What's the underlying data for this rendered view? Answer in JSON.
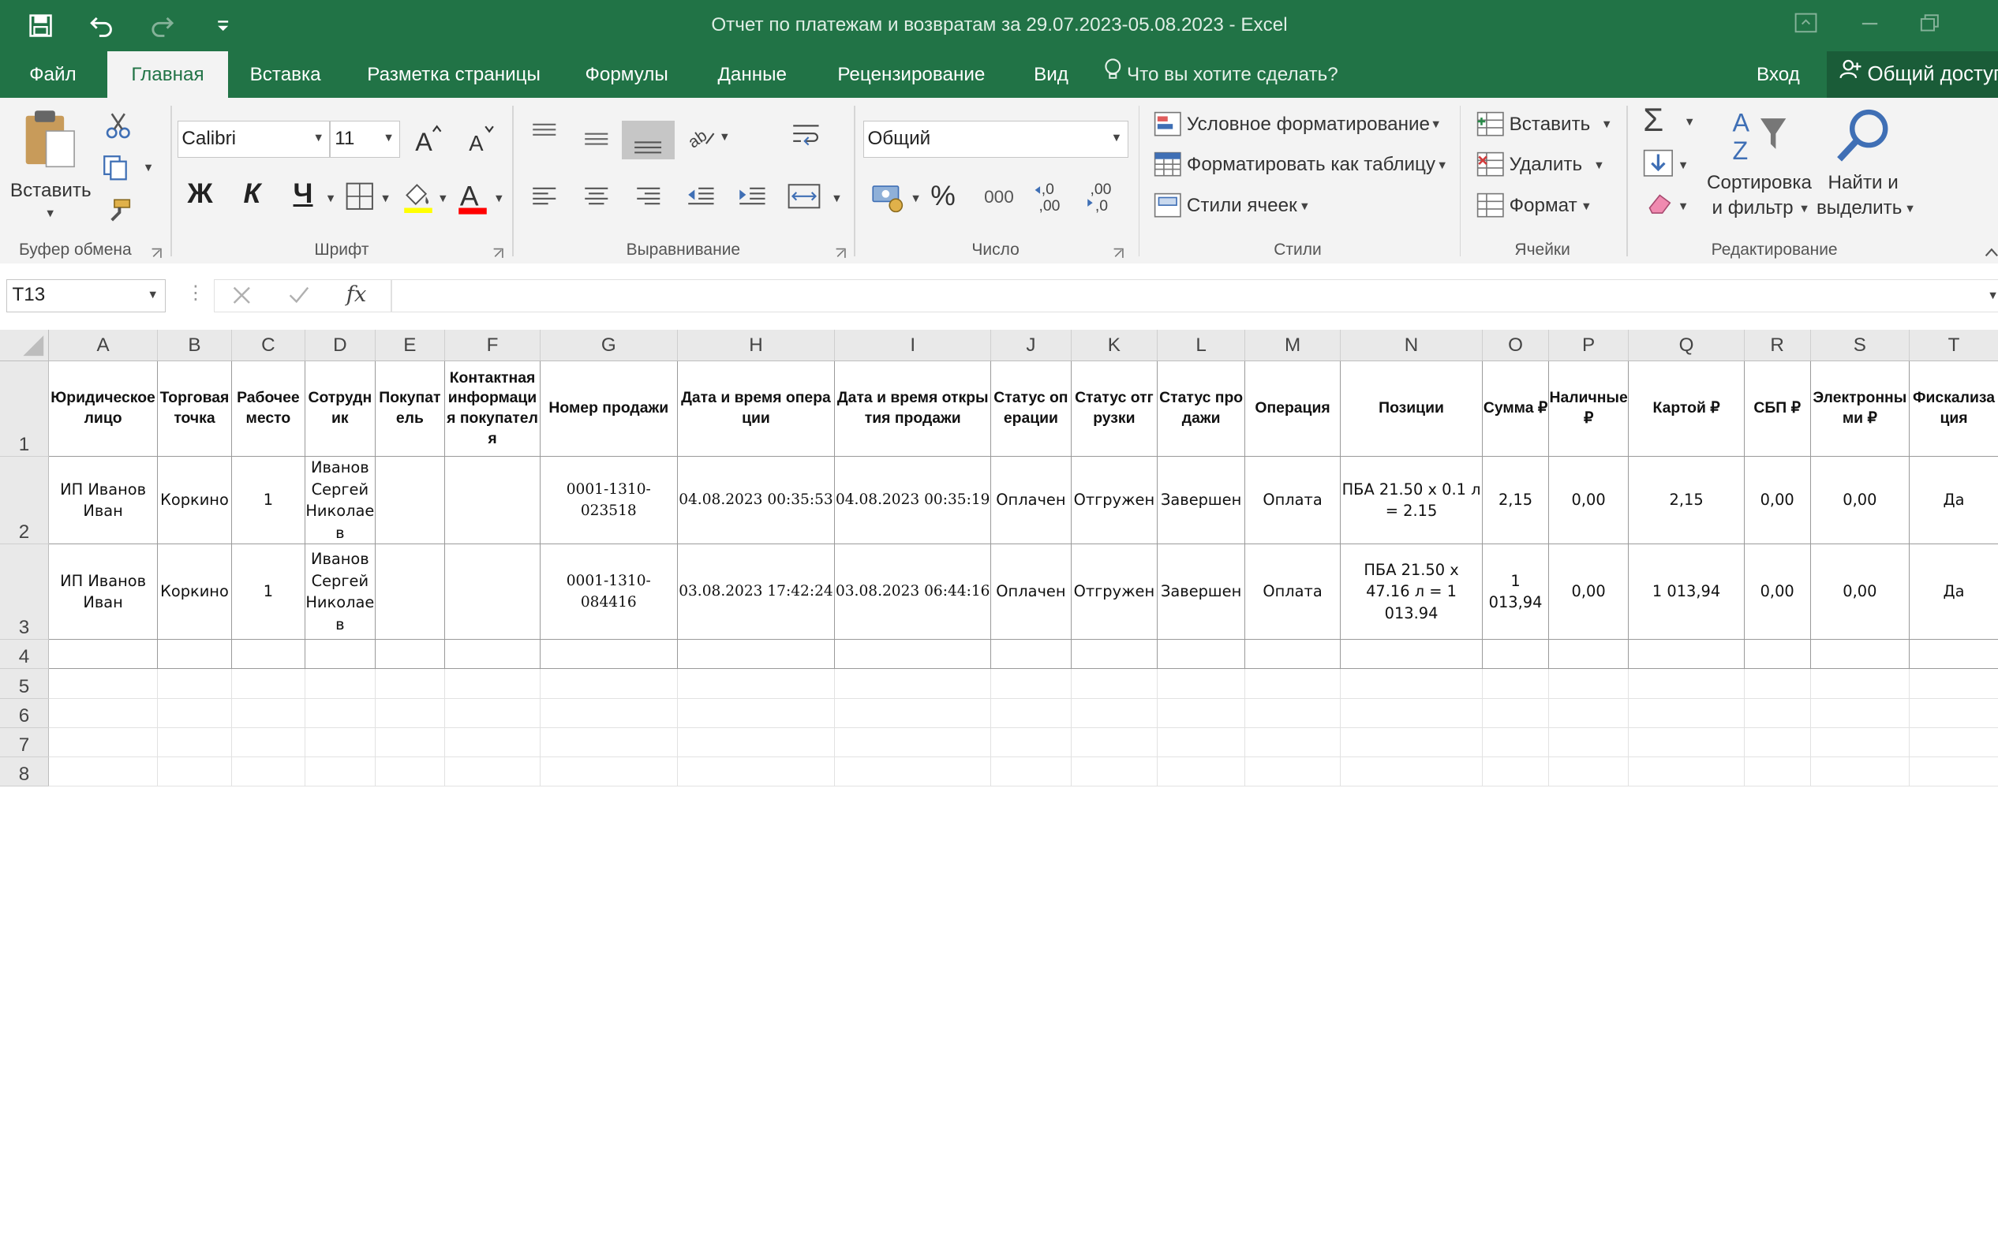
{
  "window": {
    "title": "Отчет по платежам и возвратам за 29.07.2023-05.08.2023 - Excel"
  },
  "tabs": [
    {
      "label": "Файл"
    },
    {
      "label": "Главная"
    },
    {
      "label": "Вставка"
    },
    {
      "label": "Разметка страницы"
    },
    {
      "label": "Формулы"
    },
    {
      "label": "Данные"
    },
    {
      "label": "Рецензирование"
    },
    {
      "label": "Вид"
    }
  ],
  "tell_me": {
    "placeholder": "Что вы хотите сделать?"
  },
  "account": {
    "sign_in": "Вход",
    "share": "Общий доступ"
  },
  "ribbon": {
    "clipboard": {
      "label": "Буфер обмена",
      "paste": "Вставить"
    },
    "font": {
      "label": "Шрифт",
      "font_name": "Calibri",
      "font_size": "11",
      "bold": "Ж",
      "italic": "К",
      "underline": "Ч"
    },
    "alignment": {
      "label": "Выравнивание"
    },
    "number": {
      "label": "Число",
      "format": "Общий",
      "percent": "%",
      "thousands": "000",
      "inc_decimal": "←,0\n,00",
      "dec_decimal": ",00\n→,0"
    },
    "styles": {
      "label": "Стили",
      "conditional": "Условное форматирование",
      "as_table": "Форматировать как таблицу",
      "cell_styles": "Стили ячеек"
    },
    "cells": {
      "label": "Ячейки",
      "insert": "Вставить",
      "delete": "Удалить",
      "format": "Формат"
    },
    "editing": {
      "label": "Редактирование",
      "sort_line1": "Сортировка",
      "sort_line2": "и фильтр",
      "find_line1": "Найти и",
      "find_line2": "выделить"
    }
  },
  "formula_bar": {
    "name_box": "T13",
    "fx": "fx",
    "formula": ""
  },
  "sheet": {
    "columns": [
      "A",
      "B",
      "C",
      "D",
      "E",
      "F",
      "G",
      "H",
      "I",
      "J",
      "K",
      "L",
      "M",
      "N",
      "O",
      "P",
      "Q",
      "R",
      "S",
      "T"
    ],
    "rows": [
      "1",
      "2",
      "3",
      "4",
      "5",
      "6",
      "7",
      "8"
    ],
    "headers": [
      "Юридическое лицо",
      "Торговая точка",
      "Рабочее место",
      "Сотрудник",
      "Покупатель",
      "Контактная информация покупателя",
      "Номер продажи",
      "Дата и время операции",
      "Дата и время открытия продажи",
      "Статус операции",
      "Статус отгрузки",
      "Статус продажи",
      "Операция",
      "Позиции",
      "Сумма ₽",
      "Наличные ₽",
      "Картой ₽",
      "СБП ₽",
      "Электронными ₽",
      "Фискализация"
    ],
    "data": [
      [
        "ИП Иванов Иван",
        "Коркино",
        "1",
        "Иванов Сергей Николаев",
        "",
        "",
        "0001-1310-023518",
        "04.08.2023 00:35:53",
        "04.08.2023 00:35:19",
        "Оплачен",
        "Отгружен",
        "Завершен",
        "Оплата",
        "ПБА 21.50 x 0.1 л = 2.15",
        "2,15",
        "0,00",
        "2,15",
        "0,00",
        "0,00",
        "Да"
      ],
      [
        "ИП Иванов Иван",
        "Коркино",
        "1",
        "Иванов Сергей Николаев",
        "",
        "",
        "0001-1310-084416",
        "03.08.2023 17:42:24",
        "03.08.2023 06:44:16",
        "Оплачен",
        "Отгружен",
        "Завершен",
        "Оплата",
        "ПБА 21.50 x 47.16 л = 1 013.94",
        "1 013,94",
        "0,00",
        "1 013,94",
        "0,00",
        "0,00",
        "Да"
      ]
    ]
  }
}
